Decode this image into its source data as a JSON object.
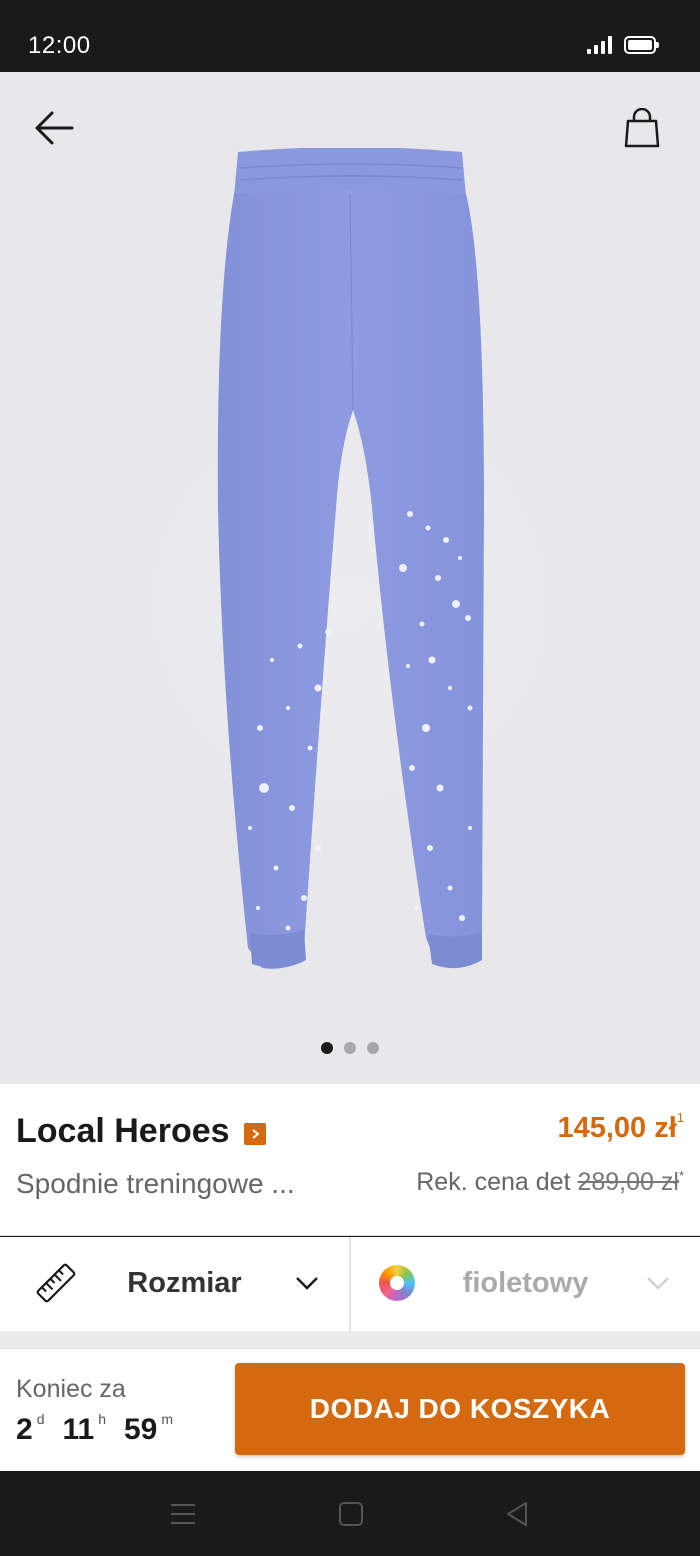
{
  "status_bar": {
    "time": "12:00"
  },
  "gallery": {
    "image_alt": "purple bleached sweatpants",
    "active_dot": 0,
    "dot_count": 3
  },
  "product": {
    "brand": "Local Heroes",
    "name": "Spodnie treningowe ...",
    "price": "145,00 zł",
    "price_footnote": "1",
    "rrp_label": "Rek. cena det",
    "rrp_value": "289,00 zł",
    "rrp_footnote": "*"
  },
  "selectors": {
    "size_label": "Rozmiar",
    "color_label": "fioletowy"
  },
  "footer": {
    "ends_label": "Koniec za",
    "days": "2",
    "days_unit": "d",
    "hours": "11",
    "hours_unit": "h",
    "minutes": "59",
    "minutes_unit": "m",
    "add_to_cart": "DODAJ DO KOSZYKA"
  },
  "colors": {
    "accent": "#d4690f",
    "product": "#8e9bdf"
  }
}
